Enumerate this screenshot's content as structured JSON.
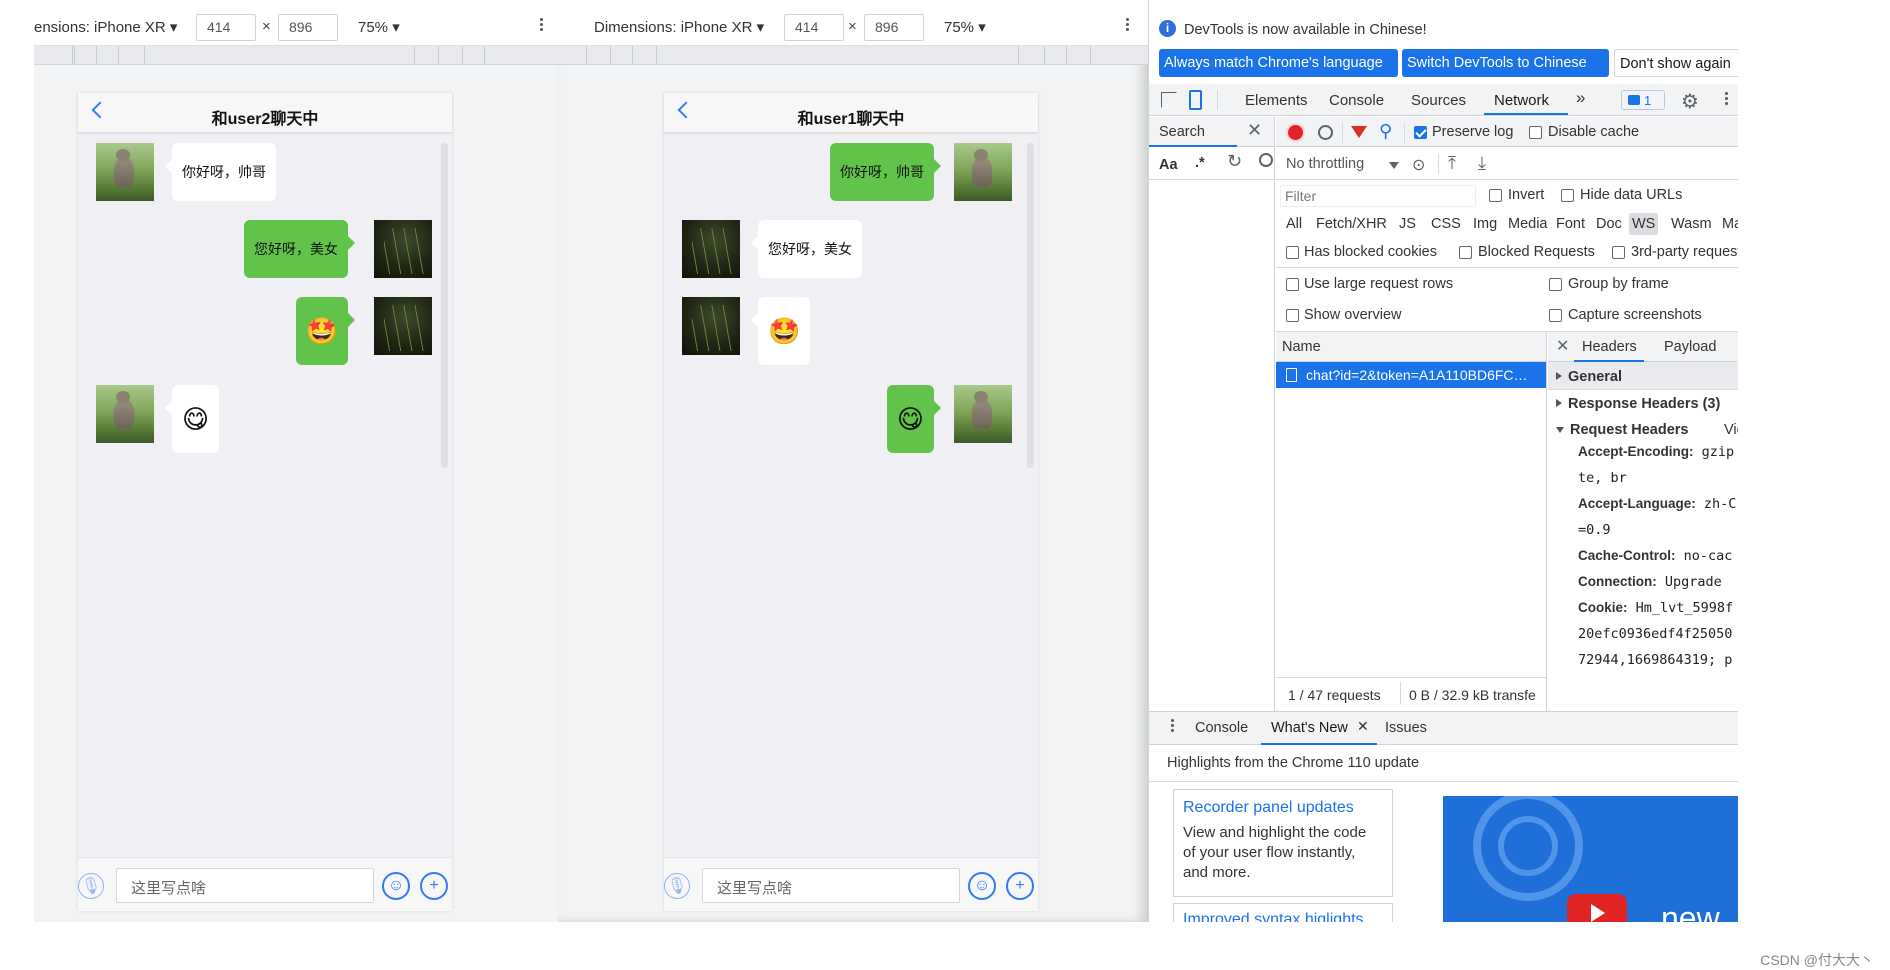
{
  "left_pane": {
    "device_label": "ensions: iPhone XR ▾",
    "width": "414",
    "height": "896",
    "times": "×",
    "zoom": "75% ▾",
    "chat_title": "和user2聊天中",
    "messages": [
      {
        "side": "left",
        "type": "text",
        "text": "你好呀，帅哥",
        "avatar": "cat-avatar"
      },
      {
        "side": "right",
        "type": "text",
        "text": "您好呀，美女",
        "avatar": "grass-avatar"
      },
      {
        "side": "right",
        "type": "emoji",
        "text": "🤩",
        "avatar": "grass-avatar"
      },
      {
        "side": "left",
        "type": "emoji",
        "text": "😋",
        "avatar": "cat-avatar"
      }
    ],
    "input_placeholder": "这里写点啥"
  },
  "right_pane": {
    "device_label": "Dimensions: iPhone XR ▾",
    "width": "414",
    "height": "896",
    "times": "×",
    "zoom": "75% ▾",
    "chat_title": "和user1聊天中",
    "messages": [
      {
        "side": "right",
        "type": "text",
        "text": "你好呀，帅哥",
        "avatar": "cat-avatar"
      },
      {
        "side": "left",
        "type": "text",
        "text": "您好呀，美女",
        "avatar": "grass-avatar"
      },
      {
        "side": "left",
        "type": "emoji",
        "text": "🤩",
        "avatar": "grass-avatar"
      },
      {
        "side": "right",
        "type": "emoji",
        "text": "😋",
        "avatar": "cat-avatar"
      }
    ],
    "input_placeholder": "这里写点啥"
  },
  "devtools": {
    "info_icon": "i",
    "banner": "DevTools is now available in Chinese!",
    "btn_match": "Always match Chrome's language",
    "btn_switch": "Switch DevTools to Chinese",
    "btn_dont": "Don't show again",
    "tabs": [
      "Elements",
      "Console",
      "Sources",
      "Network"
    ],
    "more_tabs": "»",
    "issues_badge": "1",
    "search_label": "Search",
    "aa_label": "Aa",
    "regex_label": ".*",
    "preserve_log": "Preserve log",
    "disable_cache": "Disable cache",
    "throttling": "No throttling",
    "filter_placeholder": "Filter",
    "invert": "Invert",
    "hide_data_urls": "Hide data URLs",
    "type_filters": [
      "All",
      "Fetch/XHR",
      "JS",
      "CSS",
      "Img",
      "Media",
      "Font",
      "Doc",
      "WS",
      "Wasm",
      "Ma"
    ],
    "blocked_cookies": "Has blocked cookies",
    "blocked_requests": "Blocked Requests",
    "third_party": "3rd-party request",
    "large_rows": "Use large request rows",
    "group_by_frame": "Group by frame",
    "show_overview": "Show overview",
    "capture_screenshots": "Capture screenshots",
    "name_header": "Name",
    "request_row": "chat?id=2&token=A1A110BD6FC…",
    "status_requests": "1 / 47 requests",
    "status_transfer": "0 B / 32.9 kB transfe",
    "detail_tabs": [
      "Headers",
      "Payload"
    ],
    "general": "General",
    "response_headers": "Response Headers (3)",
    "request_headers": "Request Headers",
    "view_source": "View",
    "headers": [
      {
        "key": "Accept-Encoding:",
        "value": "gzip"
      },
      {
        "key": "",
        "value": "te, br"
      },
      {
        "key": "Accept-Language:",
        "value": "zh-C"
      },
      {
        "key": "",
        "value": "=0.9"
      },
      {
        "key": "Cache-Control:",
        "value": "no-cac"
      },
      {
        "key": "Connection:",
        "value": "Upgrade"
      },
      {
        "key": "Cookie:",
        "value": "Hm_lvt_5998f"
      },
      {
        "key": "",
        "value": "20efc0936edf4f25050"
      },
      {
        "key": "",
        "value": "72944,1669864319; p"
      }
    ],
    "drawer_tabs": [
      "Console",
      "What's New",
      "Issues"
    ],
    "highlights": "Highlights from the Chrome 110 update",
    "card1_title": "Recorder panel updates",
    "card1_desc_lines": [
      "View and highlight the code",
      "of your user flow instantly,",
      "and more."
    ],
    "card2_title": "Improved syntax higlights",
    "promo_text": "new"
  },
  "watermark": "CSDN @付大大丶"
}
